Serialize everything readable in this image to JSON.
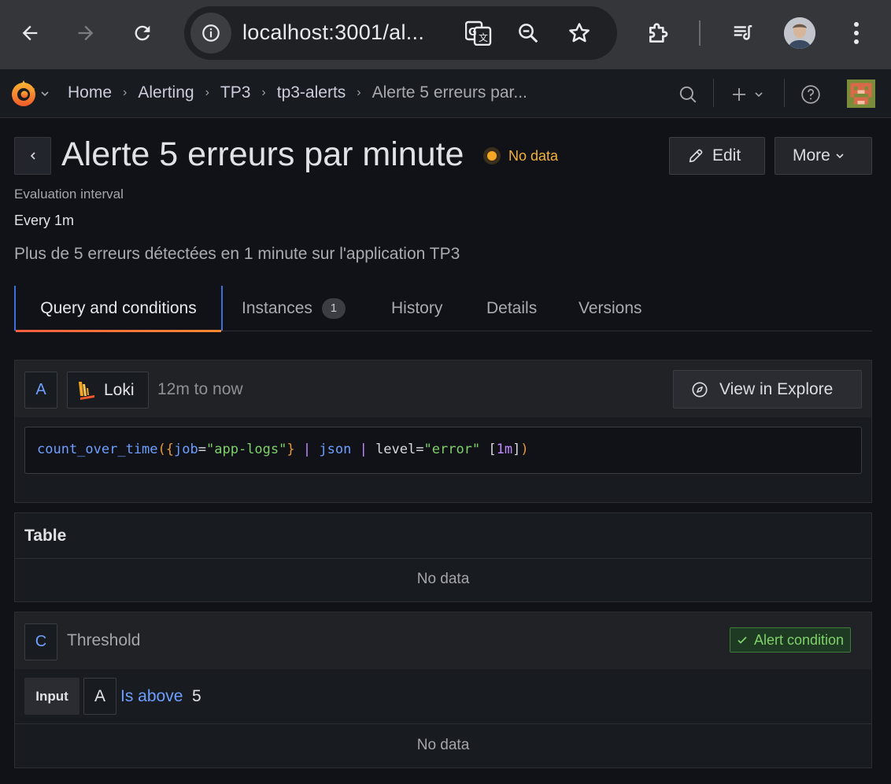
{
  "browser": {
    "url": "localhost:3001/al...",
    "icons": [
      "back-arrow",
      "forward-arrow",
      "reload",
      "site-info",
      "translate",
      "zoom-out",
      "bookmark-star",
      "extensions",
      "media-playlist",
      "profile-avatar",
      "kebab-menu"
    ]
  },
  "topbar": {
    "breadcrumbs": [
      "Home",
      "Alerting",
      "TP3",
      "tp3-alerts",
      "Alerte 5 erreurs par..."
    ]
  },
  "header": {
    "title": "Alerte 5 erreurs par minute",
    "state": "No data",
    "edit_label": "Edit",
    "more_label": "More"
  },
  "meta": {
    "eval_label": "Evaluation interval",
    "eval_value": "Every 1m",
    "description": "Plus de 5 erreurs détectées en 1 minute sur l'application TP3"
  },
  "tabs": [
    {
      "label": "Query and conditions",
      "active": true
    },
    {
      "label": "Instances",
      "count": "1"
    },
    {
      "label": "History"
    },
    {
      "label": "Details"
    },
    {
      "label": "Versions"
    }
  ],
  "query": {
    "ref": "A",
    "datasource": "Loki",
    "time_range": "12m to now",
    "explore_label": "View in Explore",
    "expr": {
      "fn": "count_over_time",
      "open_paren": "(",
      "open_brace": "{",
      "label_key": "job",
      "eq1": "=",
      "label_val": "\"app-logs\"",
      "close_brace": "}",
      "pipe1": "|",
      "parser": "json",
      "pipe2": "|",
      "filter_key": "level",
      "eq2": "=",
      "filter_val": "\"error\"",
      "range_open": "[",
      "range_val": "1m",
      "range_close": "]",
      "close_paren": ")"
    }
  },
  "table": {
    "title": "Table",
    "empty": "No data"
  },
  "threshold": {
    "ref": "C",
    "title": "Threshold",
    "badge": "Alert condition",
    "input_label": "Input",
    "input_ref": "A",
    "op": "Is above",
    "value": "5",
    "empty": "No data"
  },
  "colors": {
    "accent": "#6e9fff",
    "warning": "#f5a623",
    "success": "#7fd16a",
    "tab_active_underline": "#ff8833"
  }
}
